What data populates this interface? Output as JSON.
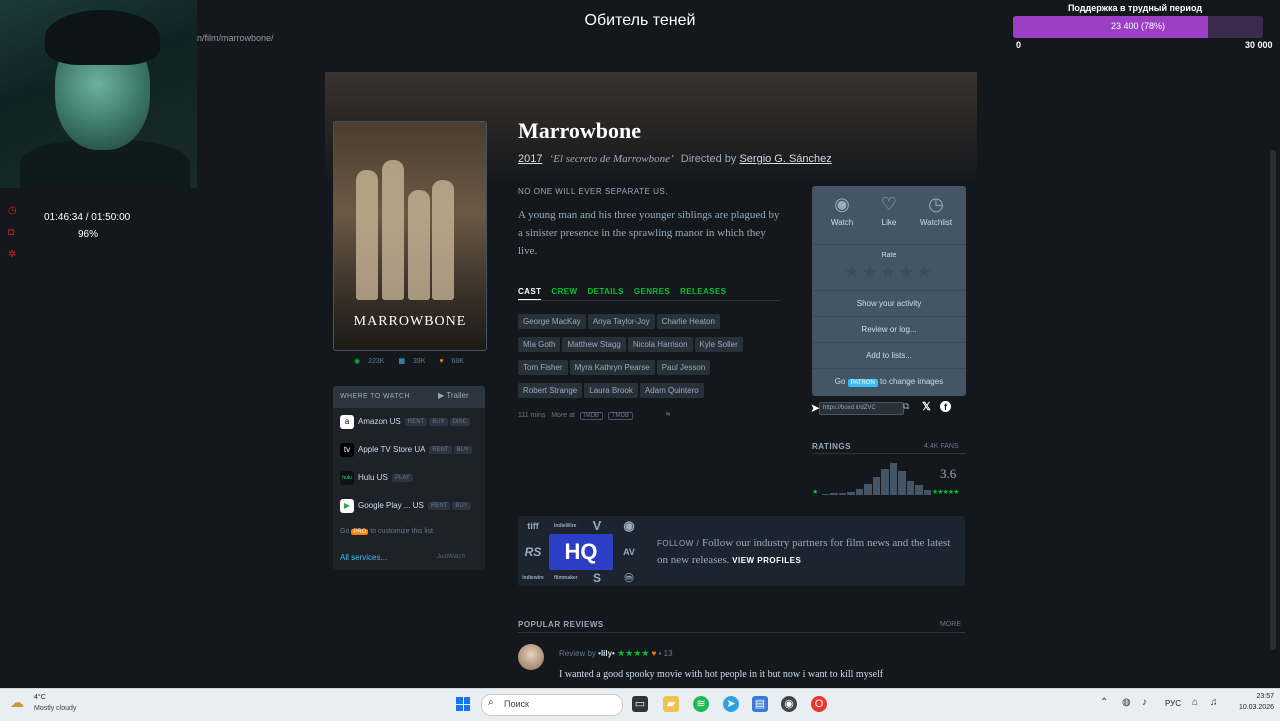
{
  "overlay": {
    "stream_title": "Обитель теней",
    "support_title": "Поддержка в трудный период",
    "progress_text": "23 400  (78%)",
    "progress_fraction": 0.78,
    "progress_min": "0",
    "progress_max": "30 000",
    "timer": "01:46:34 / 01:50:00",
    "timer_pct": "96%",
    "url_fragment": "n/film/marrowbone/"
  },
  "film": {
    "title": "Marrowbone",
    "year": "2017",
    "alt_title": "‘El secreto de Marrowbone’",
    "directed_by": "Directed by",
    "director": "Sergio G. Sánchez",
    "tagline": "NO ONE WILL EVER SEPARATE US.",
    "synopsis": "A young man and his three younger siblings are plagued by a sinister presence in the sprawling manor in which they live.",
    "poster_title": "MARROWBONE",
    "stats": {
      "watched": "223K",
      "lists": "39K",
      "likes": "68K"
    }
  },
  "tabs": [
    "CAST",
    "CREW",
    "DETAILS",
    "GENRES",
    "RELEASES"
  ],
  "cast": [
    "George MacKay",
    "Anya Taylor-Joy",
    "Charlie Heaton",
    "Mia Goth",
    "Matthew Stagg",
    "Nicola Harrison",
    "Kyle Soller",
    "Tom Fisher",
    "Myra Kathryn Pearse",
    "Paul Jesson",
    "Robert Strange",
    "Laura Brook",
    "Adam Quintero"
  ],
  "runtime": {
    "mins": "111 mins",
    "more_at": "More at",
    "imdb": "IMDB",
    "tmdb": "TMDB"
  },
  "where_to_watch": {
    "title": "WHERE TO WATCH",
    "trailer": "Trailer",
    "services": [
      {
        "logo": "a",
        "name": "Amazon US",
        "tags": [
          "RENT",
          "BUY",
          "DISC"
        ]
      },
      {
        "logo": "tv",
        "name": "Apple TV Store UA",
        "tags": [
          "RENT",
          "BUY"
        ]
      },
      {
        "logo": "hulu",
        "name": "Hulu US",
        "tags": [
          "PLAY"
        ]
      },
      {
        "logo": "▶",
        "name": "Google Play ... US",
        "tags": [
          "RENT",
          "BUY"
        ]
      }
    ],
    "go_pro_prefix": "Go",
    "pro_badge": "PRO",
    "go_pro_suffix": "to customize this list",
    "all_services": "All services...",
    "justwatch": "JustWatch"
  },
  "actions": {
    "watch": "Watch",
    "like": "Like",
    "watchlist": "Watchlist",
    "rate": "Rate",
    "show_activity": "Show your activity",
    "review_log": "Review or log...",
    "add_lists": "Add to lists...",
    "go": "Go",
    "patron": "PATRON",
    "change_images": "to change images",
    "share_url": "https://boxd.it/dZVC"
  },
  "ratings": {
    "label": "RATINGS",
    "fans": "4.4K FANS",
    "average": "3.6",
    "low_star": "★",
    "high_stars": "★★★★★",
    "histogram": [
      0.04,
      0.05,
      0.06,
      0.1,
      0.2,
      0.35,
      0.55,
      0.8,
      1.0,
      0.75,
      0.45,
      0.3,
      0.15
    ]
  },
  "partners": {
    "logos": [
      "tiff",
      "IndieWire",
      "V",
      "◉",
      "RS",
      "AV",
      "indiewire",
      "filmmaker",
      "S",
      "ⓜ"
    ],
    "hq": "HQ",
    "follow": "FOLLOW /",
    "text": "Follow our industry partners for film news and the latest on new releases.",
    "view_profiles": "VIEW PROFILES"
  },
  "reviews": {
    "title": "POPULAR REVIEWS",
    "more": "MORE",
    "review_by": "Review by",
    "user": "•lily•",
    "stars": "★★★★",
    "comments": "13",
    "text": "I wanted a good spooky movie with hot people in it but now i want to kill myself"
  },
  "taskbar": {
    "temp": "4°C",
    "weather": "Mostly cloudy",
    "search": "Поиск",
    "lang": "РУС",
    "time": "23:57",
    "date": "10.03.2026"
  }
}
